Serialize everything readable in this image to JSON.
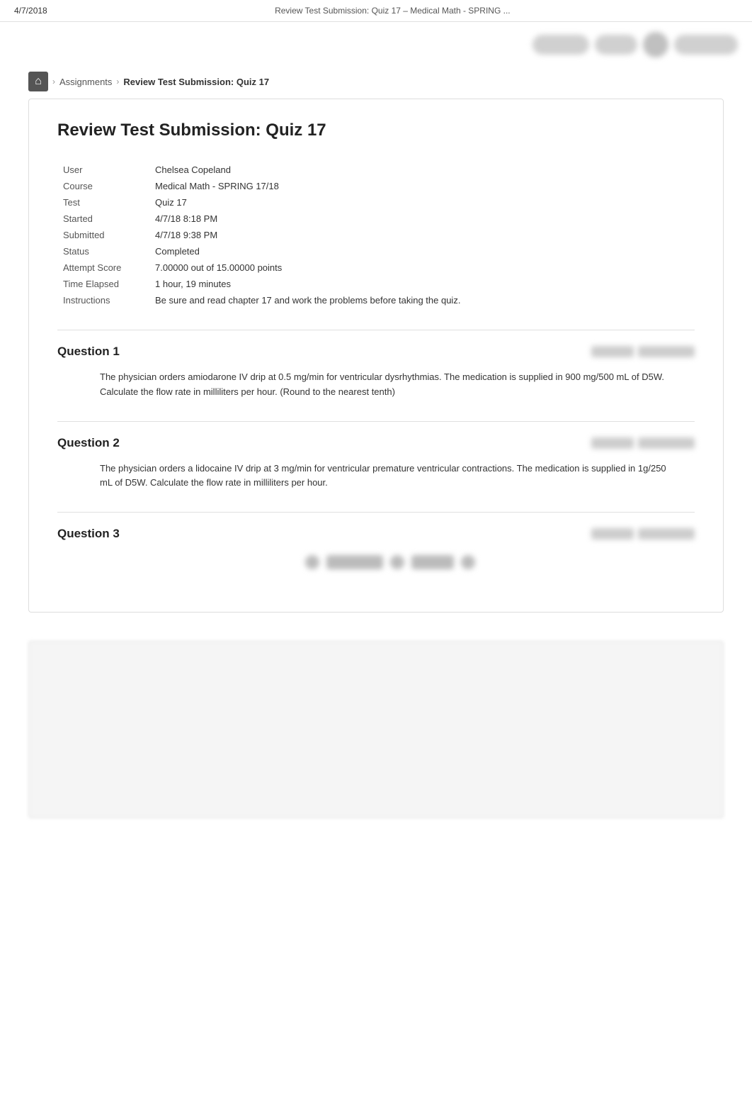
{
  "topBar": {
    "date": "4/7/2018",
    "title": "Review Test Submission: Quiz 17 – Medical Math - SPRING ..."
  },
  "breadcrumb": {
    "home_label": "⌂",
    "separator": "›",
    "assignments_label": "Assignments",
    "current_label": "Review Test Submission: Quiz 17"
  },
  "pageTitle": "Review Test Submission: Quiz 17",
  "infoTable": {
    "fields": [
      {
        "label": "User",
        "value": "Chelsea Copeland"
      },
      {
        "label": "Course",
        "value": "Medical Math - SPRING 17/18"
      },
      {
        "label": "Test",
        "value": "Quiz 17"
      },
      {
        "label": "Started",
        "value": "4/7/18 8:18 PM"
      },
      {
        "label": "Submitted",
        "value": "4/7/18 9:38 PM"
      },
      {
        "label": "Status",
        "value": "Completed"
      },
      {
        "label": "Attempt Score",
        "value": "7.00000 out of 15.00000 points"
      },
      {
        "label": "Time Elapsed",
        "value": "1 hour, 19 minutes"
      },
      {
        "label": "Instructions",
        "value": "Be sure and read chapter 17 and work the problems before taking the quiz."
      }
    ]
  },
  "questions": [
    {
      "id": "q1",
      "title": "Question 1",
      "text": "The physician orders amiodarone IV drip at 0.5 mg/min for ventricular dysrhythmias. The medication is supplied in 900 mg/500 mL of D5W. Calculate the flow rate in milliliters per hour. (Round to the nearest tenth)"
    },
    {
      "id": "q2",
      "title": "Question 2",
      "text": "The physician orders a lidocaine IV drip at 3 mg/min for ventricular premature ventricular contractions. The medication is supplied in 1g/250 mL of D5W. Calculate the flow rate in milliliters per hour."
    },
    {
      "id": "q3",
      "title": "Question 3",
      "text": ""
    }
  ]
}
